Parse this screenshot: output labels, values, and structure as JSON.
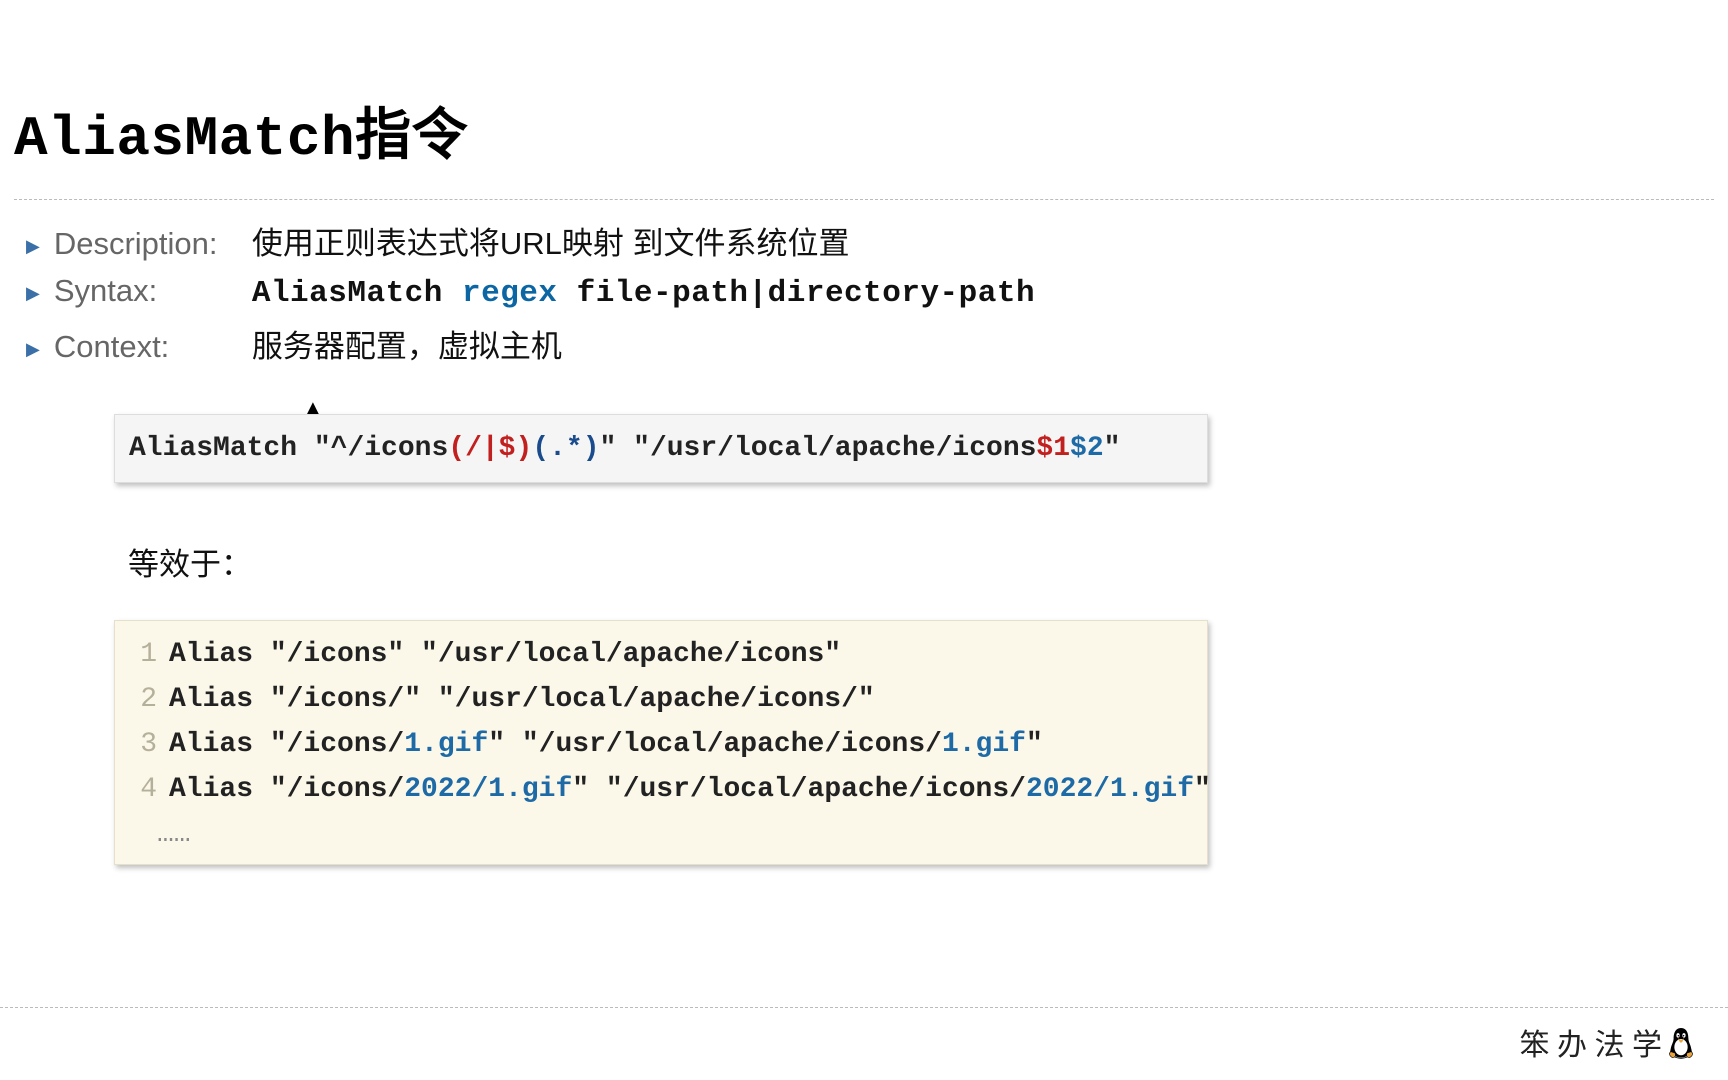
{
  "title_mono": "AliasMatch",
  "title_cjk": "指令",
  "meta": {
    "description_label": "Description:",
    "description_value": "使用正则表达式将URL映射 到文件系统位置",
    "syntax_label": "Syntax:",
    "syntax_prefix": "AliasMatch ",
    "syntax_regex": "regex",
    "syntax_suffix": " file-path|directory-path",
    "context_label": "Context:",
    "context_value": "服务器配置，虚拟主机"
  },
  "code1": {
    "p1": "AliasMatch \"",
    "p2": "^/icons",
    "g1_open": "(",
    "g1_body": "/|$",
    "g1_close": ")",
    "g2_open": "(",
    "g2_body": ".*",
    "g2_close": ")",
    "p3": "\" \"/usr/local/apache/icons",
    "b1": "$1",
    "b2": "$2",
    "p4": "\""
  },
  "equiv_label": "等效于：",
  "lines": [
    {
      "n": "1",
      "a": "Alias \"/icons\" \"/usr/local/apache/icons\"",
      "num1": "",
      "mid": "",
      "num2": "",
      "tail": ""
    },
    {
      "n": "2",
      "a": "Alias \"/icons/\" \"/usr/local/apache/icons/\"",
      "num1": "",
      "mid": "",
      "num2": "",
      "tail": ""
    },
    {
      "n": "3",
      "a": "Alias \"/icons/",
      "num1": "1.gif",
      "mid": "\" \"/usr/local/apache/icons/",
      "num2": "1.gif",
      "tail": "\""
    },
    {
      "n": "4",
      "a": "Alias \"/icons/",
      "num1": "2022/1.gif",
      "mid": "\" \"/usr/local/apache/icons/",
      "num2": "2022/1.gif",
      "tail": "\""
    }
  ],
  "ellipsis": "……",
  "footer": "笨 办 法 学"
}
